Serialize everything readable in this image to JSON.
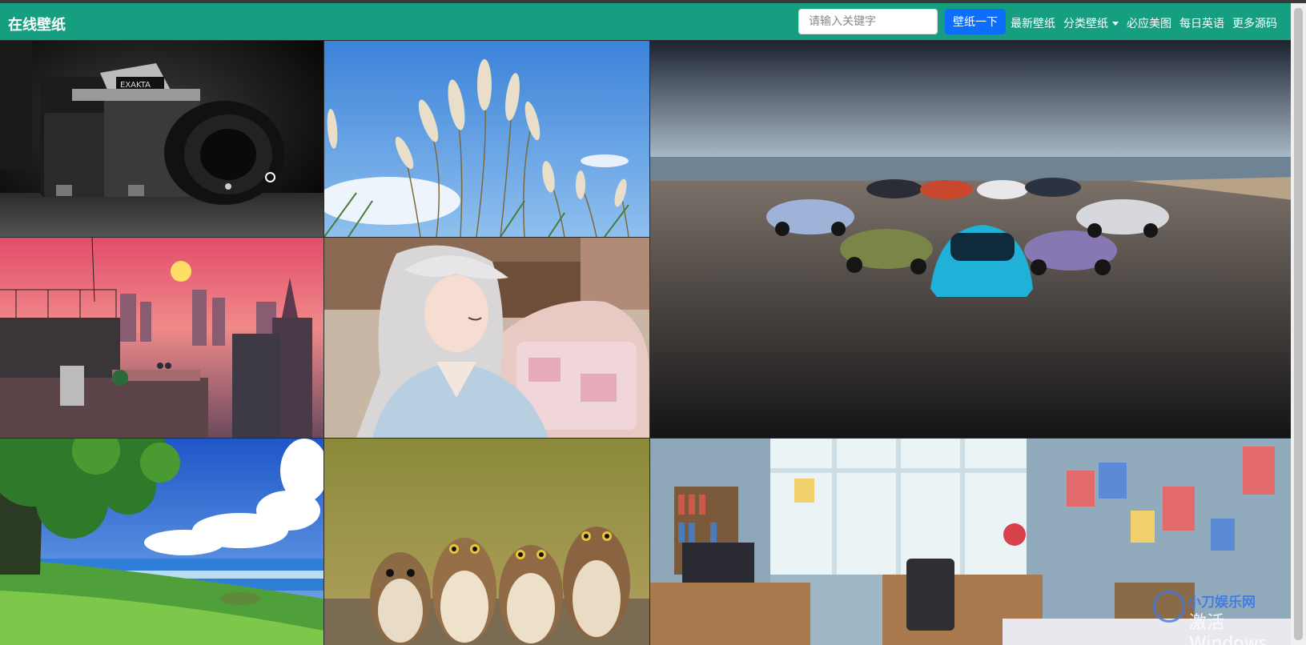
{
  "navbar": {
    "brand": "在线壁纸",
    "search_placeholder": "请输入关键字",
    "search_button": "壁纸一下",
    "links": [
      {
        "label": "最新壁纸"
      },
      {
        "label": "分类壁纸",
        "dropdown": true
      },
      {
        "label": "必应美图"
      },
      {
        "label": "每日英语"
      },
      {
        "label": "更多源码"
      }
    ],
    "color": "#169e80",
    "button_color": "#0d6efd"
  },
  "wallpapers": [
    {
      "name": "camera-wallpaper",
      "subject": "vintage camera black and white",
      "camera_text": "EXAKTA"
    },
    {
      "name": "grass-wallpaper",
      "subject": "pampas grass under blue sky"
    },
    {
      "name": "cars-wallpaper",
      "subject": "electric cars on beach"
    },
    {
      "name": "city-wallpaper",
      "subject": "anime city rooftop sunset"
    },
    {
      "name": "girl-wallpaper",
      "subject": "anime girl with silver hair"
    },
    {
      "name": "field-wallpaper",
      "subject": "anime meadow and sea"
    },
    {
      "name": "owls-wallpaper",
      "subject": "four owls"
    },
    {
      "name": "room-wallpaper",
      "subject": "anime bedroom with windows"
    }
  ],
  "watermark": {
    "top_text": "小刀娱乐网",
    "bottom_text": "激活 Windows"
  }
}
